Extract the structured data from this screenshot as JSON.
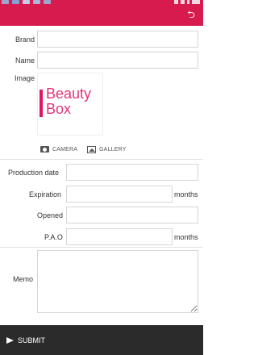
{
  "form": {
    "brand_label": "Brand",
    "brand_value": "",
    "name_label": "Name",
    "name_value": "",
    "image_label": "Image",
    "image_logo_line1": "Beauty",
    "image_logo_line2": "Box",
    "camera_label": "CAMERA",
    "gallery_label": "GALLERY",
    "production_date_label": "Production date",
    "production_date_value": "",
    "expiration_label": "Expiration",
    "expiration_value": "",
    "expiration_unit": "months",
    "opened_label": "Opened",
    "opened_value": "",
    "pao_label": "P.A.O",
    "pao_value": "",
    "pao_unit": "months",
    "memo_label": "Memo",
    "memo_value": ""
  },
  "footer": {
    "submit_label": "SUBMIT"
  },
  "colors": {
    "accent": "#d81b4f",
    "logo": "#e3337a",
    "footer": "#2b2b2b"
  },
  "icons": {
    "back": "back-arrow-icon",
    "camera": "camera-icon",
    "gallery": "gallery-icon",
    "submit": "send-icon"
  }
}
